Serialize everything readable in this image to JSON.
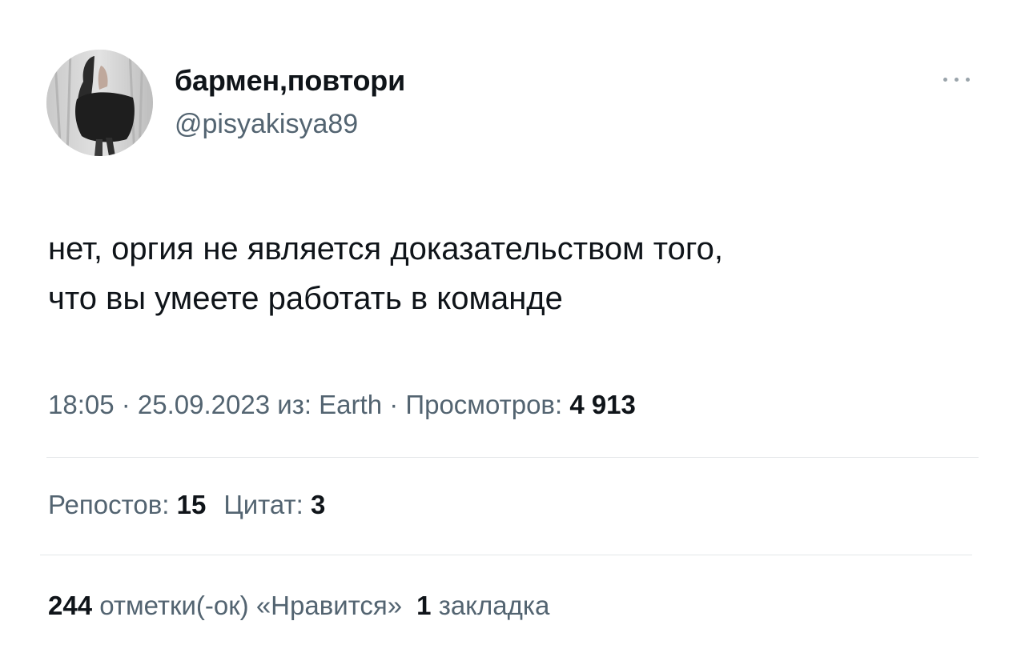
{
  "author": {
    "display_name": "бармен,повтори",
    "handle": "@pisyakisya89"
  },
  "icons": {
    "more": "more-horizontal-icon",
    "avatar": "profile-photo"
  },
  "tweet": {
    "text_lines": [
      "нет, оргия не является доказательством того,",
      "что вы умеете работать в команде"
    ]
  },
  "meta": {
    "time": "18:05",
    "separator": " · ",
    "date": "25.09.2023",
    "source_label": "из: Earth",
    "views_label": "Просмотров:",
    "views_count": "4 913"
  },
  "stats": {
    "reposts": {
      "label": "Репостов:",
      "count": "15"
    },
    "quotes": {
      "label": "Цитат:",
      "count": "3"
    },
    "likes": {
      "count": "244",
      "label": "отметки(-ок) «Нравится»"
    },
    "bookmarks": {
      "count": "1",
      "label": "закладка"
    }
  },
  "colors": {
    "text_primary": "#0f1419",
    "text_secondary": "#536471",
    "divider": "#e3e6e8"
  }
}
